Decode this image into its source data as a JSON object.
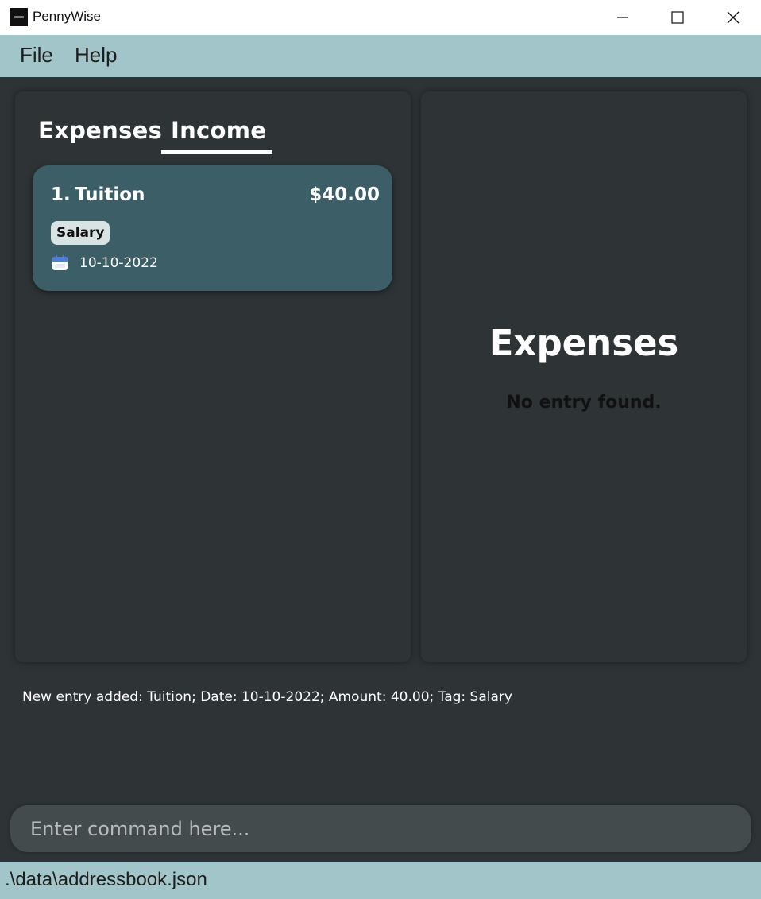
{
  "window": {
    "title": "PennyWise",
    "icon": "app-icon"
  },
  "menu": {
    "items": [
      {
        "label": "File"
      },
      {
        "label": "Help"
      }
    ]
  },
  "left_panel": {
    "tabs": [
      {
        "label": "Expenses",
        "selected": false
      },
      {
        "label": "Income",
        "selected": true
      }
    ],
    "entries": [
      {
        "index": "1.",
        "name": "Tuition",
        "amount": "$40.00",
        "tag": "Salary",
        "date": "10-10-2022",
        "date_icon": "calendar-icon"
      }
    ]
  },
  "right_panel": {
    "title": "Expenses",
    "empty_message": "No entry found."
  },
  "result": {
    "message": "New entry added: Tuition; Date: 10-10-2022; Amount: 40.00; Tag: Salary"
  },
  "command": {
    "value": "",
    "placeholder": "Enter command here..."
  },
  "status": {
    "path": ".\\data\\addressbook.json"
  },
  "colors": {
    "background": "#2e3436",
    "bar": "#a1c5c8",
    "card": "#3c5f67",
    "tag": "#d9e3e4",
    "command": "#444b4d"
  }
}
